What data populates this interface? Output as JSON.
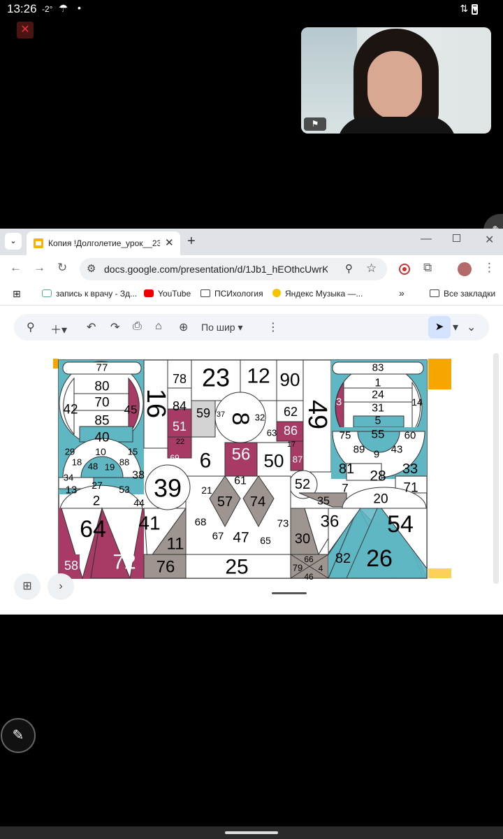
{
  "status_bar": {
    "time": "13:26",
    "temperature": "-2°",
    "weather_icon": "umbrella-icon",
    "notification_dot": "•"
  },
  "browser": {
    "tab_title": "Копия !Долголетие_урок__23",
    "url": "docs.google.com/presentation/d/1Jb1_hEOthcUwrKBh...",
    "bookmarks": [
      {
        "label": "запись к врачу - Зд...",
        "icon": "medical-icon"
      },
      {
        "label": "YouTube",
        "icon": "youtube-icon"
      },
      {
        "label": "ПСИхология",
        "icon": "folder-icon"
      },
      {
        "label": "Яндекс Музыка —...",
        "icon": "yandex-music-icon"
      }
    ],
    "bookmarks_more": "»",
    "all_bookmarks": "Все закладки"
  },
  "slides_toolbar": {
    "zoom_label": "По шир"
  },
  "colors": {
    "teal": "#5fb7c3",
    "magenta": "#a83a66",
    "gray": "#9e9591",
    "light_gray": "#d3d3d3",
    "orange_edge": "#f7a600"
  },
  "schulte_numbers": [
    "77",
    "80",
    "70",
    "85",
    "40",
    "42",
    "45",
    "16",
    "78",
    "84",
    "51",
    "59",
    "23",
    "12",
    "90",
    "8",
    "37",
    "32",
    "62",
    "86",
    "49",
    "83",
    "1",
    "24",
    "31",
    "5",
    "3",
    "14",
    "75",
    "55",
    "60",
    "89",
    "9",
    "43",
    "81",
    "33",
    "7",
    "28",
    "71",
    "29",
    "10",
    "15",
    "18",
    "48",
    "19",
    "88",
    "34",
    "27",
    "53",
    "38",
    "13",
    "2",
    "44",
    "22",
    "69",
    "6",
    "56",
    "50",
    "63",
    "17",
    "87",
    "39",
    "21",
    "61",
    "57",
    "74",
    "52",
    "35",
    "20",
    "64",
    "41",
    "11",
    "68",
    "67",
    "47",
    "65",
    "73",
    "30",
    "36",
    "54",
    "58",
    "72",
    "76",
    "25",
    "79",
    "66",
    "4",
    "46",
    "82",
    "26"
  ]
}
